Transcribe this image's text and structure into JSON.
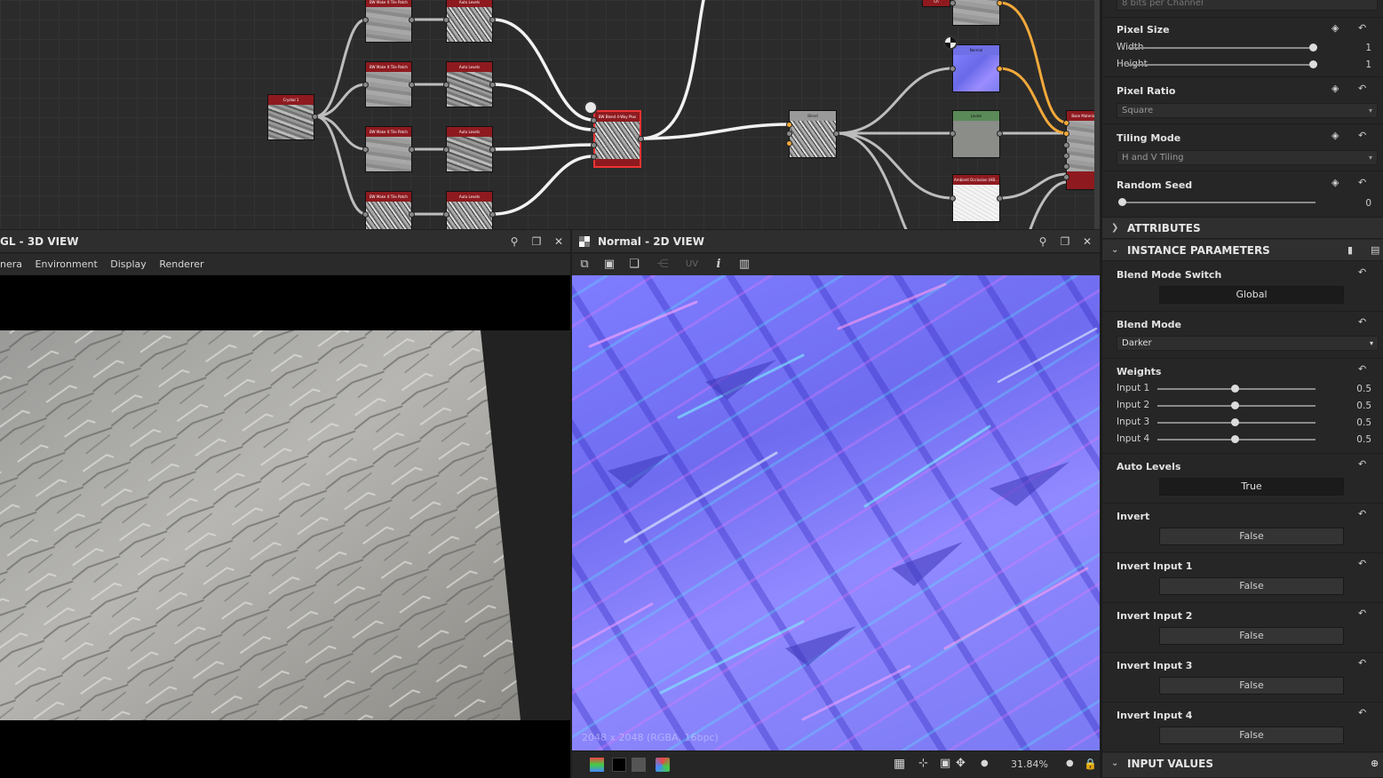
{
  "graph": {
    "nodes": [
      {
        "label": "Crystal 1"
      },
      {
        "label": "BW Make It Tile Patch"
      },
      {
        "label": "BW Make It Tile Patch"
      },
      {
        "label": "BW Make It Tile Patch"
      },
      {
        "label": "BW Make It Tile Patch"
      },
      {
        "label": "Auto Levels"
      },
      {
        "label": "Auto Levels"
      },
      {
        "label": "Auto Levels"
      },
      {
        "label": "Auto Levels"
      },
      {
        "label": "BW Blend 4-Way Plus"
      },
      {
        "label": "Blend"
      },
      {
        "label": "Normal"
      },
      {
        "label": "Levels"
      },
      {
        "label": "Ambient Occlusion (HB..."
      },
      {
        "label": "Base Material"
      },
      {
        "label": "Ch"
      }
    ]
  },
  "view3d": {
    "title": "GL - 3D VIEW",
    "menu": [
      "nera",
      "Environment",
      "Display",
      "Renderer"
    ]
  },
  "view2d": {
    "title": "Normal - 2D VIEW",
    "uv_label": "UV",
    "resolution": "2048 x 2048 (RGBA, 16bpc)",
    "zoom": "31.84%"
  },
  "properties": {
    "top_field": "8 bits per Channel",
    "pixel_size": {
      "label": "Pixel Size",
      "width_label": "Width",
      "width_value": "1",
      "height_label": "Height",
      "height_value": "1"
    },
    "pixel_ratio": {
      "label": "Pixel Ratio",
      "value": "Square"
    },
    "tiling_mode": {
      "label": "Tiling Mode",
      "value": "H and V Tiling"
    },
    "random_seed": {
      "label": "Random Seed",
      "value": "0"
    },
    "attributes_header": "ATTRIBUTES",
    "instance_header": "INSTANCE PARAMETERS",
    "blend_mode_switch": {
      "label": "Blend Mode Switch",
      "value": "Global"
    },
    "blend_mode": {
      "label": "Blend Mode",
      "value": "Darker"
    },
    "weights": {
      "label": "Weights",
      "inputs": [
        {
          "label": "Input 1",
          "value": "0.5"
        },
        {
          "label": "Input 2",
          "value": "0.5"
        },
        {
          "label": "Input 3",
          "value": "0.5"
        },
        {
          "label": "Input 4",
          "value": "0.5"
        }
      ]
    },
    "auto_levels": {
      "label": "Auto Levels",
      "value": "True"
    },
    "invert": {
      "label": "Invert",
      "value": "False"
    },
    "invert_input_1": {
      "label": "Invert Input 1",
      "value": "False"
    },
    "invert_input_2": {
      "label": "Invert Input 2",
      "value": "False"
    },
    "invert_input_3": {
      "label": "Invert Input 3",
      "value": "False"
    },
    "invert_input_4": {
      "label": "Invert Input 4",
      "value": "False"
    },
    "input_values_header": "INPUT VALUES"
  }
}
